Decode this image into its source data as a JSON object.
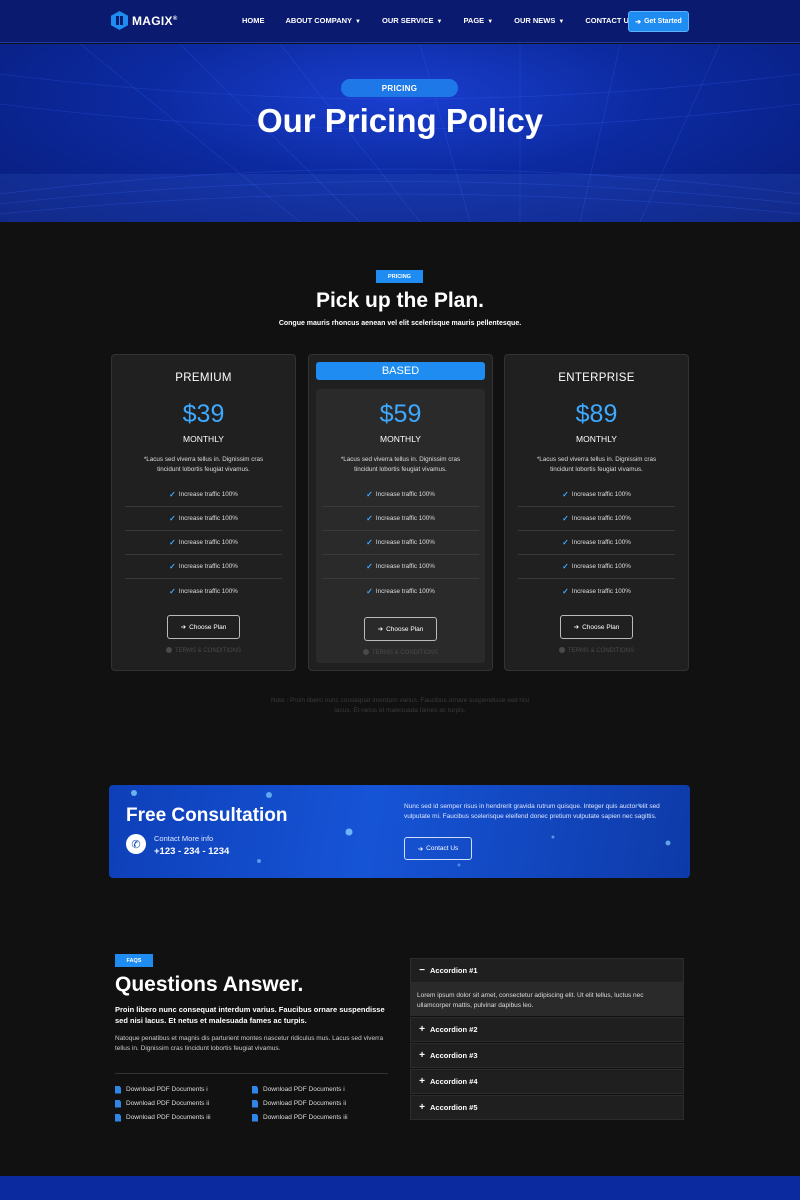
{
  "nav": {
    "logo": "MAGIX",
    "logo_mark": "®",
    "items": [
      {
        "label": "HOME",
        "dropdown": false
      },
      {
        "label": "ABOUT COMPANY",
        "dropdown": true
      },
      {
        "label": "OUR SERVICE",
        "dropdown": true
      },
      {
        "label": "PAGE",
        "dropdown": true
      },
      {
        "label": "OUR NEWS",
        "dropdown": true
      },
      {
        "label": "CONTACT US",
        "dropdown": false
      }
    ],
    "cta": "Get Started"
  },
  "hero": {
    "pill": "PRICING",
    "title": "Our Pricing Policy"
  },
  "plans": {
    "tag": "PRICING",
    "title": "Pick up the Plan.",
    "subtitle": "Congue mauris rhoncus aenean vel elit scelerisque mauris pellentesque.",
    "cards": [
      {
        "name": "PREMIUM",
        "price": "$39",
        "period": "MONTHLY",
        "featured": false,
        "description": "*Lacus sed viverra tellus in. Dignissim cras tincidunt lobortis feugiat vivamus.",
        "features": [
          "Increase traffic 100%",
          "Increase traffic 100%",
          "Increase traffic 100%",
          "Increase traffic 100%",
          "Increase traffic 100%"
        ],
        "button": "Choose Plan",
        "terms": "TERMS & CONDITIONS"
      },
      {
        "name": "BASED",
        "price": "$59",
        "period": "MONTHLY",
        "featured": true,
        "description": "*Lacus sed viverra tellus in. Dignissim cras tincidunt lobortis feugiat vivamus.",
        "features": [
          "Increase traffic 100%",
          "Increase traffic 100%",
          "Increase traffic 100%",
          "Increase traffic 100%",
          "Increase traffic 100%"
        ],
        "button": "Choose Plan",
        "terms": "TERMS & CONDITIONS"
      },
      {
        "name": "ENTERPRISE",
        "price": "$89",
        "period": "MONTHLY",
        "featured": false,
        "description": "*Lacus sed viverra tellus in. Dignissim cras tincidunt lobortis feugiat vivamus.",
        "features": [
          "Increase traffic 100%",
          "Increase traffic 100%",
          "Increase traffic 100%",
          "Increase traffic 100%",
          "Increase traffic 100%"
        ],
        "button": "Choose Plan",
        "terms": "TERMS & CONDITIONS"
      }
    ],
    "note": "Note : Proin libero nunc consequat interdum varius. Faucibus ornare suspendisse sed nisi lacus. Et netus et malesuada fames ac turpis."
  },
  "consultation": {
    "title": "Free Consultation",
    "contact_label": "Contact More info",
    "phone": "+123 - 234 - 1234",
    "text": "Nunc sed id semper risus in hendrerit gravida rutrum quisque. Integer quis auctor elit sed vulputate mi. Faucibus scelerisque eleifend donec pretium vulputate sapien nec sagittis.",
    "button": "Contact Us"
  },
  "faq": {
    "tag": "FAQS",
    "title": "Questions Answer.",
    "lead": "Proin libero nunc consequat interdum varius. Faucibus ornare suspendisse sed nisi lacus. Et netus et malesuada fames ac turpis.",
    "body": "Natoque penatibus et magnis dis parturient montes nascetur ridiculus mus. Lacus sed viverra tellus in. Dignissim cras tincidunt lobortis feugiat vivamus.",
    "documents": [
      "Download PDF Documents i",
      "Download PDF Documents i",
      "Download PDF Documents ii",
      "Download PDF Documents ii",
      "Download PDF Documents iii",
      "Download PDF Documents iii"
    ],
    "accordion": [
      {
        "title": "Accordion #1",
        "open": true,
        "content": "Lorem ipsum dolor sit amet, consectetur adipiscing elit. Ut elit tellus, luctus nec ullamcorper mattis, pulvinar dapibus leo."
      },
      {
        "title": "Accordion #2",
        "open": false
      },
      {
        "title": "Accordion #3",
        "open": false
      },
      {
        "title": "Accordion #4",
        "open": false
      },
      {
        "title": "Accordion #5",
        "open": false
      }
    ]
  },
  "colors": {
    "accent": "#1e8cf0",
    "price": "#3da9ff",
    "nav_bg": "#0a1a6e",
    "page_bg": "#111111"
  }
}
